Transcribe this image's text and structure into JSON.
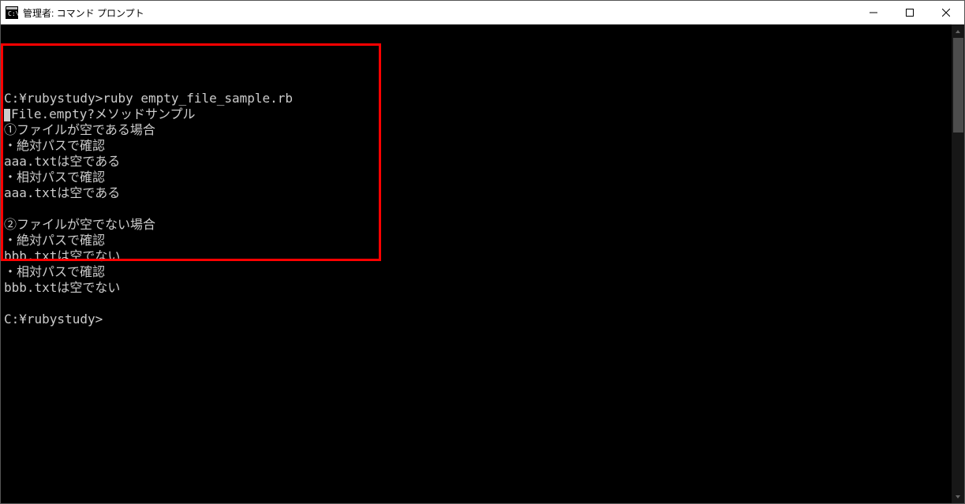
{
  "window": {
    "title": "管理者: コマンド プロンプト"
  },
  "terminal": {
    "lines": [
      "",
      "C:¥rubystudy>ruby empty_file_sample.rb",
      "■File.empty?メソッドサンプル",
      "①ファイルが空である場合",
      "・絶対パスで確認",
      "aaa.txtは空である",
      "・相対パスで確認",
      "aaa.txtは空である",
      "",
      "②ファイルが空でない場合",
      "・絶対パスで確認",
      "bbb.txtは空でない",
      "・相対パスで確認",
      "bbb.txtは空でない",
      "",
      "C:¥rubystudy>"
    ]
  }
}
